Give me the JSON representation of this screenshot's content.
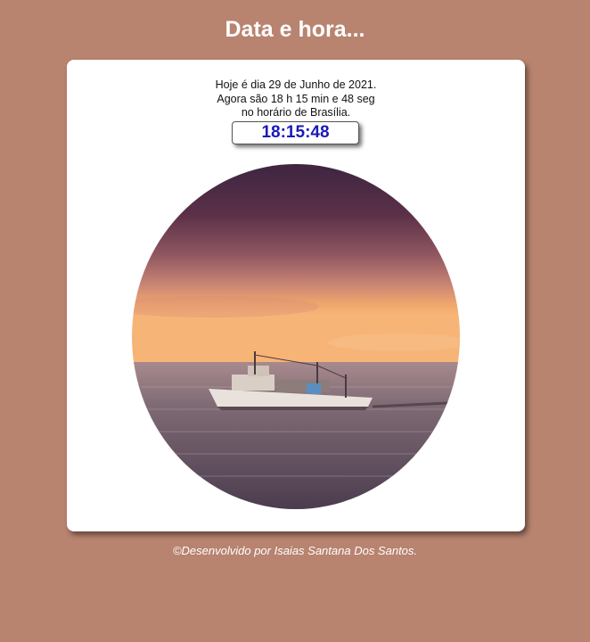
{
  "page": {
    "title": "Data e hora..."
  },
  "card": {
    "date_line": "Hoje é dia 29 de Junho de 2021.",
    "time_line": "Agora são 18 h 15 min e 48 seg",
    "zone_line": "no horário de Brasília.",
    "clock": "18:15:48"
  },
  "image": {
    "subject": "fishing-boat-at-sunset",
    "colors": {
      "sky_top": "#472840",
      "sky_mid": "#b77877",
      "sky_horizon": "#f2a86c",
      "sea": "#6c5c6a",
      "background": "#b8836f",
      "clock_text": "#1a1ab8"
    }
  },
  "footer": {
    "credit": "©Desenvolvido por Isaias Santana Dos Santos."
  }
}
